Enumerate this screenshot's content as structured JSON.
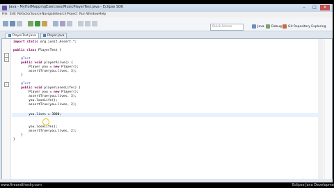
{
  "window": {
    "title": "Java - MyHotMappingExercises/MusicPlayerTest.java - Eclipse SDK",
    "controls": {
      "minimize": "–",
      "maximize": "□",
      "close": "✕"
    },
    "accent": "#6a4fa0"
  },
  "menu": [
    "File",
    "Edit",
    "Refactor",
    "Source",
    "Navigate",
    "Search",
    "Project",
    "Run",
    "Window",
    "Help"
  ],
  "toolbar": {
    "quick_access_placeholder": "Quick Access",
    "perspectives": [
      "Java",
      "Debug",
      "Git Repository Exploring"
    ]
  },
  "tabs": [
    {
      "label": "PlayerTest.java",
      "active": true
    },
    {
      "label": "Player.java",
      "active": false
    }
  ],
  "editor": {
    "lines": [
      {
        "segments": [
          {
            "t": "import static ",
            "c": "kw"
          },
          {
            "t": "org.junit.Assert.*;",
            "c": ""
          }
        ]
      },
      {
        "segments": []
      },
      {
        "segments": [
          {
            "t": "public class ",
            "c": "kw"
          },
          {
            "t": "PlayerTest {",
            "c": ""
          }
        ]
      },
      {
        "segments": []
      },
      {
        "segments": [
          {
            "t": "    @Test",
            "c": "cm"
          }
        ]
      },
      {
        "segments": [
          {
            "t": "    public void ",
            "c": "kw"
          },
          {
            "t": "playerAlive() {",
            "c": ""
          }
        ]
      },
      {
        "segments": [
          {
            "t": "        Player you = ",
            "c": ""
          },
          {
            "t": "new ",
            "c": "kw"
          },
          {
            "t": "Player();",
            "c": ""
          }
        ]
      },
      {
        "segments": [
          {
            "t": "        assertTrue(you.lives, 3);",
            "c": ""
          }
        ]
      },
      {
        "segments": [
          {
            "t": "    }",
            "c": ""
          }
        ]
      },
      {
        "segments": []
      },
      {
        "segments": [
          {
            "t": "    @Test",
            "c": "cm"
          }
        ]
      },
      {
        "segments": [
          {
            "t": "    public void ",
            "c": "kw"
          },
          {
            "t": "playerLosesLife() {",
            "c": ""
          }
        ]
      },
      {
        "segments": [
          {
            "t": "        Player you = ",
            "c": ""
          },
          {
            "t": "new ",
            "c": "kw"
          },
          {
            "t": "Player();",
            "c": ""
          }
        ]
      },
      {
        "segments": [
          {
            "t": "        assertTrue(you.lives, 3);",
            "c": ""
          }
        ]
      },
      {
        "segments": [
          {
            "t": "        you.loseLife();",
            "c": ""
          }
        ]
      },
      {
        "segments": [
          {
            "t": "        assertTrue(you.lives, 2);",
            "c": ""
          }
        ]
      },
      {
        "segments": []
      },
      {
        "segments": [
          {
            "t": "        you.lives = 3000;",
            "c": ""
          }
        ]
      },
      {
        "segments": []
      },
      {
        "segments": []
      },
      {
        "segments": [
          {
            "t": "        you.loseLife();",
            "c": ""
          }
        ]
      },
      {
        "segments": [
          {
            "t": "        assertTrue(you.lives, 2);",
            "c": ""
          }
        ]
      },
      {
        "segments": [
          {
            "t": "    }",
            "c": ""
          }
        ]
      },
      {
        "segments": [
          {
            "t": "}",
            "c": ""
          }
        ]
      }
    ]
  },
  "taskbar": {
    "url": "www.fireandthesky.com",
    "right_text": "Eclipse Java Development"
  }
}
